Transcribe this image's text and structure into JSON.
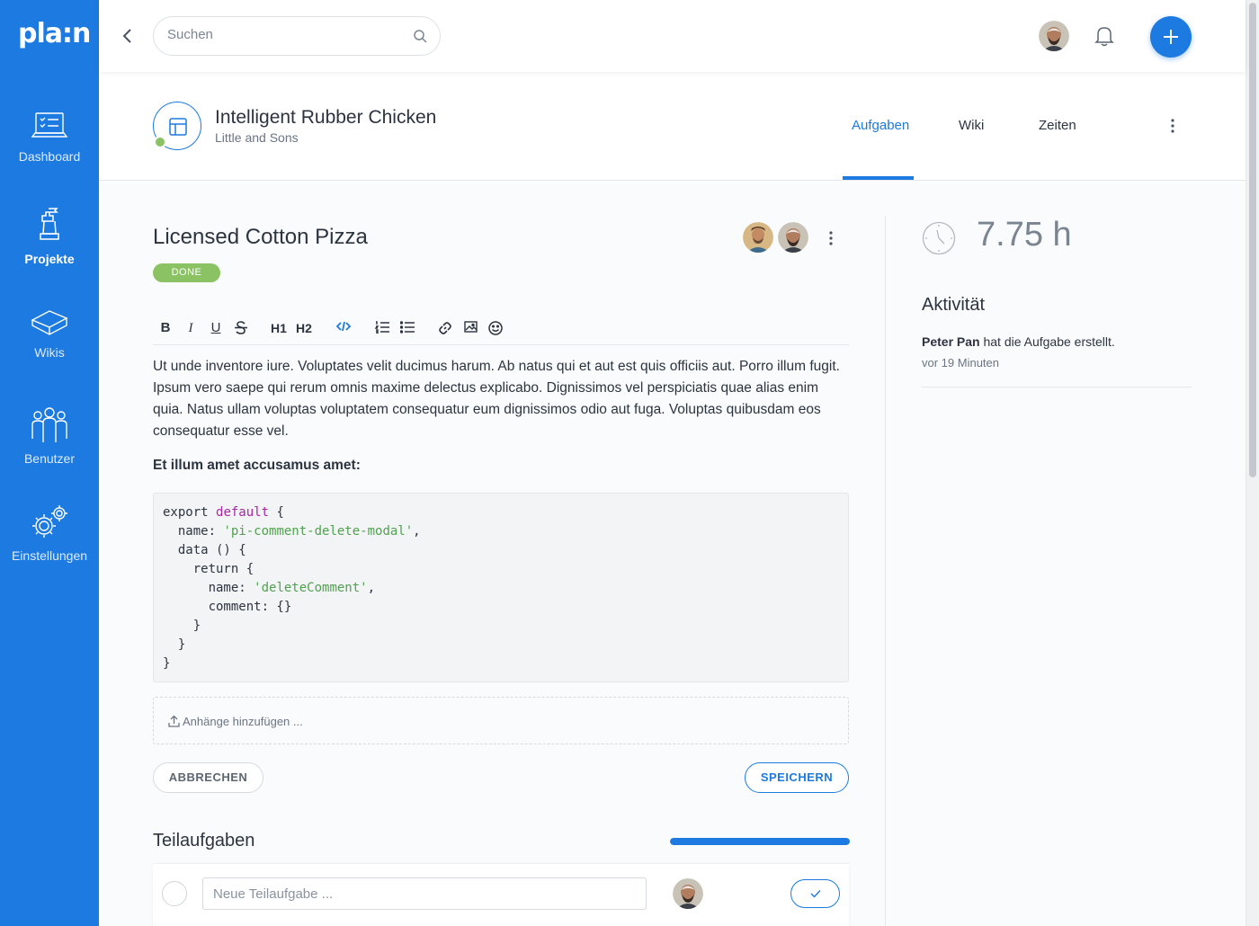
{
  "sidebar": {
    "logo": "pla:n",
    "items": [
      {
        "label": "Dashboard",
        "icon": "dashboard-icon"
      },
      {
        "label": "Projekte",
        "icon": "projects-icon",
        "active": true
      },
      {
        "label": "Wikis",
        "icon": "wiki-book-icon"
      },
      {
        "label": "Benutzer",
        "icon": "users-icon"
      },
      {
        "label": "Einstellungen",
        "icon": "gear-icon"
      }
    ]
  },
  "topbar": {
    "search_placeholder": "Suchen"
  },
  "project": {
    "title": "Intelligent Rubber Chicken",
    "subtitle": "Little and Sons",
    "tabs": [
      {
        "label": "Aufgaben",
        "active": true
      },
      {
        "label": "Wiki"
      },
      {
        "label": "Zeiten"
      }
    ]
  },
  "task": {
    "title": "Licensed Cotton Pizza",
    "status": "DONE",
    "paragraph": "Ut unde inventore iure. Voluptates velit ducimus harum. Ab natus qui et aut est quis officiis aut. Porro illum fugit. Ipsum vero saepe qui rerum omnis maxime delectus explicabo. Dignissimos vel perspiciatis quae alias enim quia. Natus ullam voluptas voluptatem consequatur eum dignissimos odio aut fuga. Voluptas quibusdam eos consequatur esse vel.",
    "subheading": "Et illum amet accusamus amet:",
    "code": {
      "l1a": "export ",
      "l1kw": "default",
      "l1b": " {",
      "l2a": "  name: ",
      "l2s": "'pi-comment-delete-modal'",
      "l2b": ",",
      "l3": "  data () {",
      "l4": "    return {",
      "l5a": "      name: ",
      "l5s": "'deleteComment'",
      "l5b": ",",
      "l6": "      comment: {}",
      "l7": "    }",
      "l8": "  }",
      "l9": "}"
    },
    "toolbar": {
      "bold": "B",
      "italic": "I",
      "underline": "U",
      "h1": "H1",
      "h2": "H2"
    },
    "attachments_label": "Anhänge hinzufügen ...",
    "cancel_label": "ABBRECHEN",
    "save_label": "SPEICHERN"
  },
  "subtasks": {
    "title": "Teilaufgaben",
    "progress": 1.0,
    "input_placeholder": "Neue Teilaufgabe ..."
  },
  "time": {
    "hours": "7.75 h"
  },
  "activity": {
    "title": "Aktivität",
    "entries": [
      {
        "user": "Peter Pan",
        "action": "hat die Aufgabe erstellt.",
        "time": "vor 19 Minuten"
      }
    ]
  },
  "colors": {
    "brand": "#1c7ae0",
    "done": "#8bc263"
  }
}
